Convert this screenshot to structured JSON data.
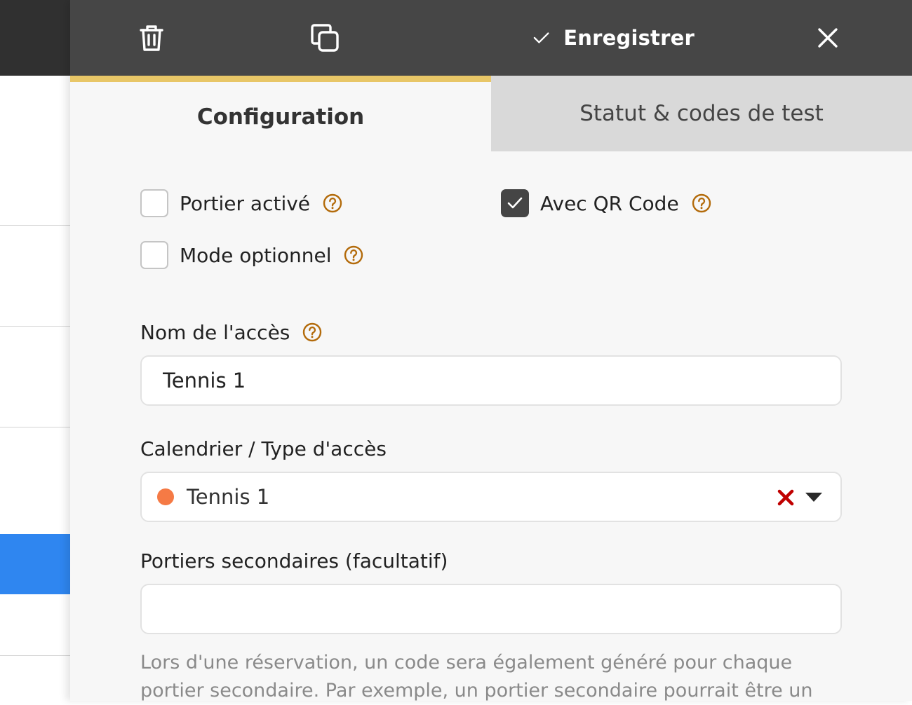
{
  "colors": {
    "toolbar_bg": "#464646",
    "tab_active_accent": "#e8c667",
    "tab_inactive_bg": "#d9d9d9",
    "help_icon": "#b36b0b",
    "calendar_dot": "#f57a45",
    "clear_x": "#c00000",
    "selected_row": "#2f86f0"
  },
  "toolbar": {
    "delete_icon": "trash-icon",
    "duplicate_icon": "copy-icon",
    "save_icon": "check-icon",
    "save_label": "Enregistrer",
    "close_icon": "close-icon"
  },
  "tabs": [
    {
      "label": "Configuration",
      "active": true
    },
    {
      "label": "Statut & codes de test",
      "active": false
    }
  ],
  "form": {
    "portier_active": {
      "label": "Portier activé",
      "checked": false
    },
    "qr_code": {
      "label": "Avec QR Code",
      "checked": true
    },
    "optional_mode": {
      "label": "Mode optionnel",
      "checked": false
    },
    "access_name": {
      "label": "Nom de l'accès",
      "value": "Tennis 1"
    },
    "calendar": {
      "label": "Calendrier / Type d'accès",
      "value": "Tennis 1"
    },
    "secondary_doors": {
      "label": "Portiers secondaires (facultatif)",
      "value": ""
    },
    "help_text": "Lors d'une réservation, un code sera également généré pour chaque portier secondaire. Par exemple, un portier secondaire pourrait être un"
  }
}
